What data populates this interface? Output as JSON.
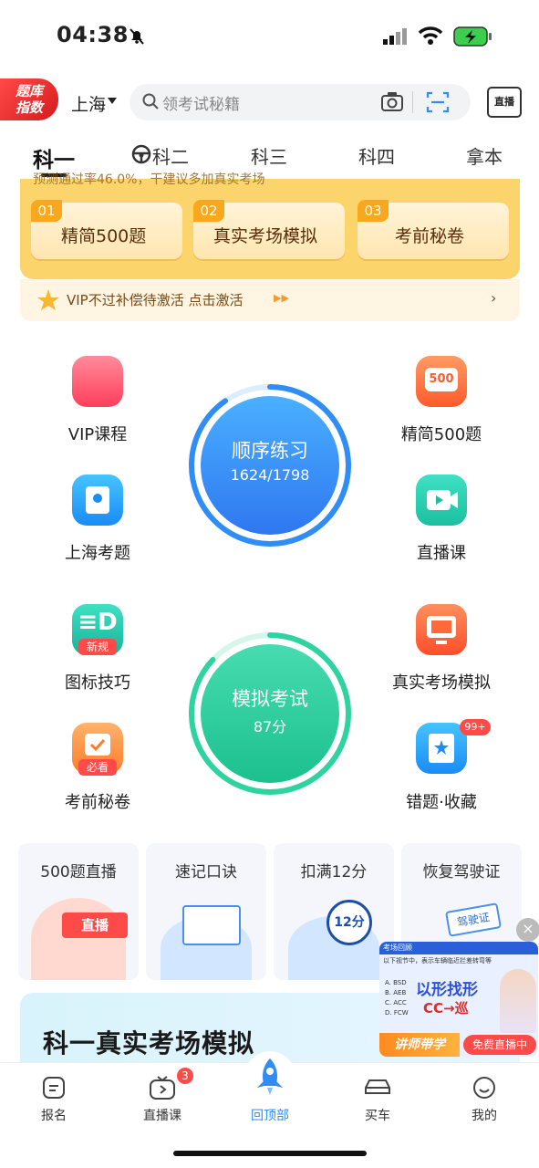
{
  "status": {
    "time": "04:38"
  },
  "header": {
    "badge_line1": "题库",
    "badge_line2": "指数",
    "city": "上海",
    "search_placeholder": "领考试秘籍",
    "live_icon_label": "直播"
  },
  "tabs": [
    {
      "label": "科一",
      "active": true
    },
    {
      "label": "科二"
    },
    {
      "label": "科三"
    },
    {
      "label": "科四"
    },
    {
      "label": "拿本"
    }
  ],
  "promo": {
    "tip": "预测通过率46.0%，干建议多加真实考场",
    "buttons": [
      {
        "num": "01",
        "label": "精简500题"
      },
      {
        "num": "02",
        "label": "真实考场模拟"
      },
      {
        "num": "03",
        "label": "考前秘卷"
      }
    ],
    "vip_text": "VIP不过补偿待激活 点击激活"
  },
  "grid": {
    "vip": "VIP课程",
    "jingjian": "精简500题",
    "shanghai": "上海考题",
    "zhibo": "直播课",
    "tubiao": "图标技巧",
    "tubiao_badge": "新规",
    "zhenshi": "真实考场模拟",
    "mijuan": "考前秘卷",
    "mijuan_badge": "必看",
    "cuoti": "错题·收藏",
    "cuoti_badge": "99+",
    "jingjian_icon": "500"
  },
  "practice": {
    "title": "顺序练习",
    "progress": "1624/1798",
    "done": 1624,
    "total": 1798
  },
  "exam": {
    "title": "模拟考试",
    "score": "87分",
    "score_value": 87
  },
  "features": [
    {
      "title": "500题直播",
      "art": "直播"
    },
    {
      "title": "速记口诀"
    },
    {
      "title": "扣满12分",
      "art": "12分"
    },
    {
      "title": "恢复驾驶证",
      "art": "驾驶证"
    }
  ],
  "banner": {
    "title": "科一真实考场模拟"
  },
  "live_video": {
    "header": "考场回顾",
    "question": "以下视节中，表示车辆临近拦差转弯等",
    "options": [
      "A. BSD",
      "B. AEB",
      "C. ACC",
      "D. FCW"
    ],
    "headline": "以形找形",
    "formula": "CC→巡",
    "tag": "讲师带学",
    "cta": "免费直播中"
  },
  "nav": [
    {
      "label": "报名"
    },
    {
      "label": "直播课",
      "badge": "3"
    },
    {
      "label": "回顶部",
      "active": true
    },
    {
      "label": "买车"
    },
    {
      "label": "我的"
    }
  ],
  "colors": {
    "accent_blue": "#2f8df5",
    "accent_green": "#2ed3a0",
    "promo_orange": "#fbd56c"
  }
}
